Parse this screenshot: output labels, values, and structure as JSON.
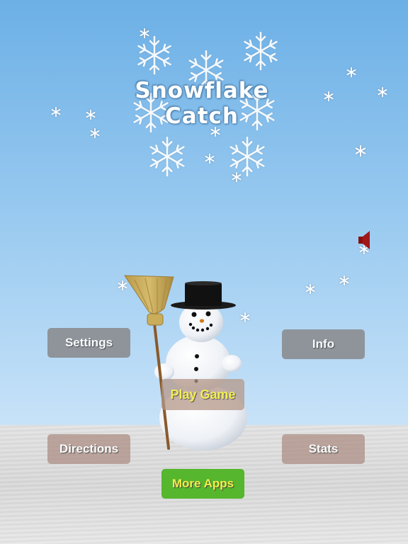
{
  "title": {
    "line1": "Snowflake",
    "line2": "Catch"
  },
  "buttons": {
    "settings": "Settings",
    "info": "Info",
    "play": "Play Game",
    "directions": "Directions",
    "stats": "Stats",
    "more_apps": "More Apps"
  },
  "icons": {
    "sound": "speaker-icon",
    "snowflake": "snowflake-icon",
    "snowman": "snowman-with-broom"
  },
  "colors": {
    "sky_top": "#6cb0e6",
    "sky_bottom": "#c7e2f8",
    "snow_ground": "#dcdcdc",
    "button_gray": "#8b8f93",
    "button_green": "#56b62d",
    "highlight_text": "#f3ee4a",
    "sound_icon": "#a01818"
  }
}
